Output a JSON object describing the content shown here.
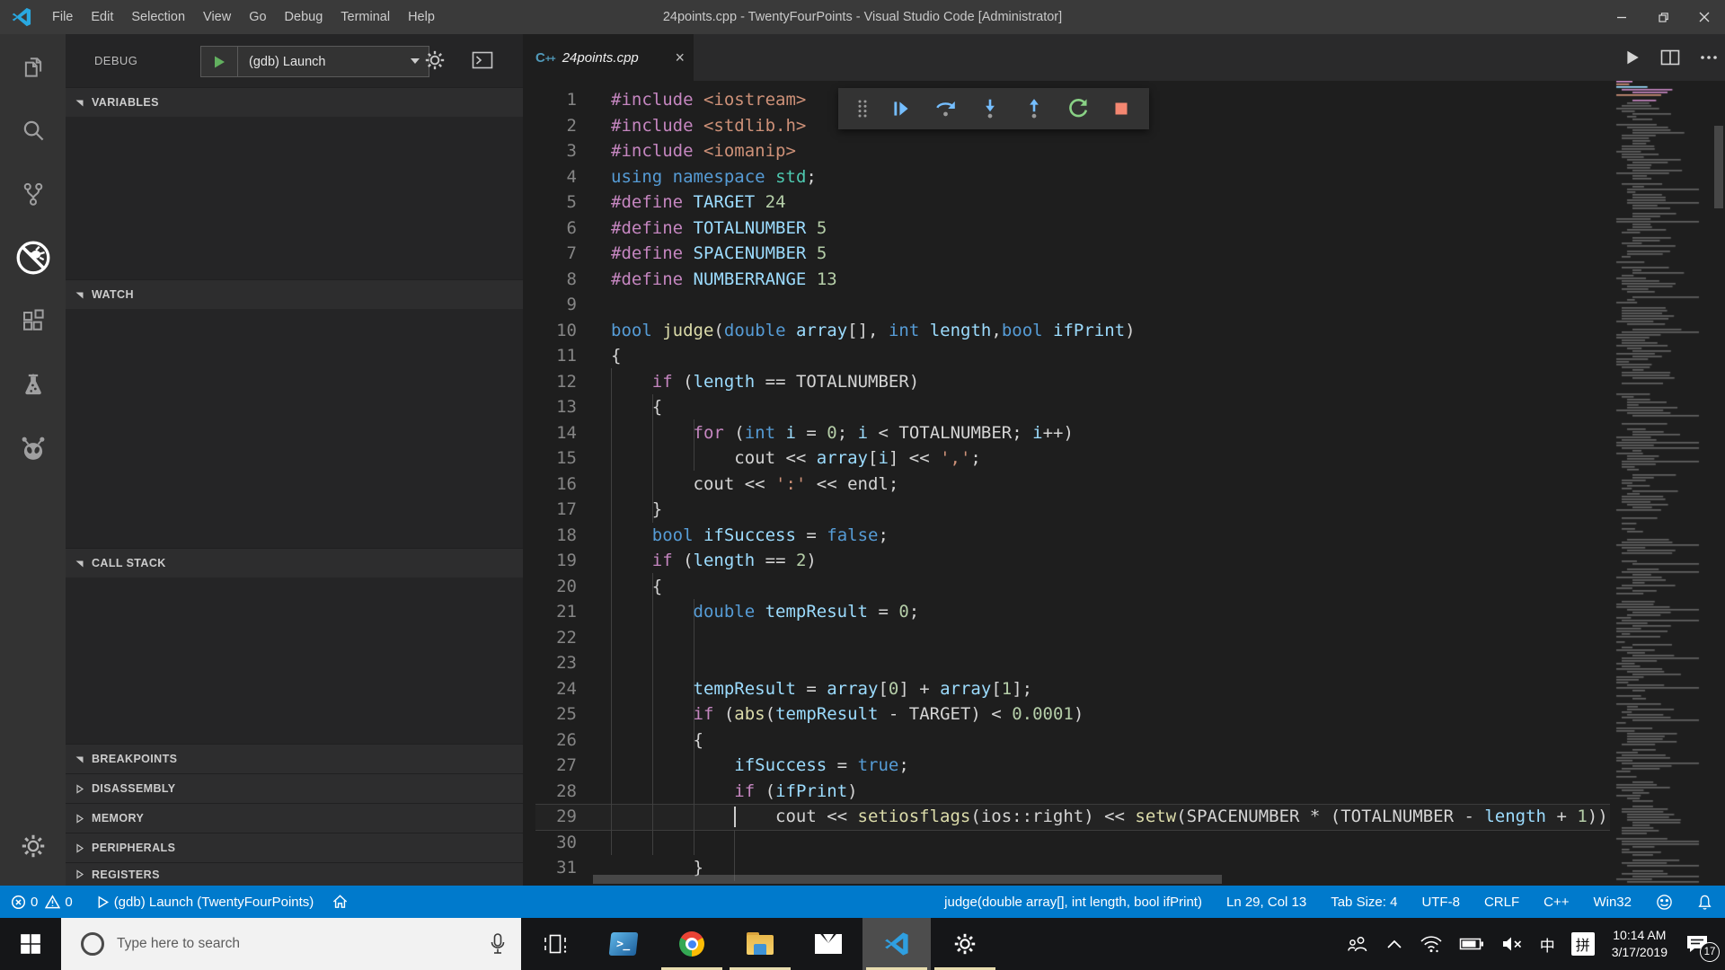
{
  "ui_colors": {
    "title_bar": "#3a3a3a",
    "activity_bar": "#333333",
    "sidebar": "#252526",
    "editor": "#1e1e1e",
    "status_bar": "#007acc",
    "taskbar": "#151618",
    "debug_continue": "#75beff",
    "debug_restart": "#89d185",
    "debug_stop": "#f48771"
  },
  "title_bar": {
    "menus": [
      "File",
      "Edit",
      "Selection",
      "View",
      "Go",
      "Debug",
      "Terminal",
      "Help"
    ],
    "title": "24points.cpp - TwentyFourPoints - Visual Studio Code [Administrator]",
    "window_buttons": [
      "minimize",
      "restore",
      "close"
    ]
  },
  "activity_bar": {
    "items": [
      "explorer",
      "search",
      "source-control",
      "debug",
      "extensions",
      "test-beaker",
      "robot"
    ],
    "active": "debug",
    "bottom": [
      "settings-gear"
    ]
  },
  "debug_panel": {
    "title": "DEBUG",
    "launch_config": "(gdb) Launch",
    "header_icons": [
      "start-debug",
      "configure-gear",
      "debug-console"
    ],
    "sections": [
      {
        "label": "VARIABLES",
        "expanded": true
      },
      {
        "label": "WATCH",
        "expanded": true
      },
      {
        "label": "CALL STACK",
        "expanded": true
      },
      {
        "label": "BREAKPOINTS",
        "expanded": true
      },
      {
        "label": "DISASSEMBLY",
        "expanded": false
      },
      {
        "label": "MEMORY",
        "expanded": false
      },
      {
        "label": "PERIPHERALS",
        "expanded": false
      },
      {
        "label": "REGISTERS",
        "expanded": false
      }
    ]
  },
  "tabs": [
    {
      "label": "24points.cpp",
      "language": "cpp",
      "active": true,
      "italic_preview": true
    }
  ],
  "tab_actions": [
    "run",
    "split-editor",
    "more-actions"
  ],
  "debug_toolbar": {
    "buttons": [
      "drag-handle",
      "continue",
      "step-over",
      "step-into",
      "step-out",
      "restart",
      "stop"
    ]
  },
  "editor": {
    "cursor": {
      "line": 29,
      "col": 13
    },
    "syntax_colors": {
      "k": "#c586c0",
      "b": "#569cd6",
      "t": "#4ec9b0",
      "f": "#dcdcaa",
      "v": "#9cdcfe",
      "n": "#b5cea8",
      "s": "#ce9178",
      "d": "#d4d4d4"
    },
    "lines": [
      {
        "num": 1,
        "tokens": [
          [
            "k",
            "#include"
          ],
          [
            "d",
            " "
          ],
          [
            "s",
            "<iostream>"
          ]
        ]
      },
      {
        "num": 2,
        "tokens": [
          [
            "k",
            "#include"
          ],
          [
            "d",
            " "
          ],
          [
            "s",
            "<stdlib.h>"
          ]
        ]
      },
      {
        "num": 3,
        "tokens": [
          [
            "k",
            "#include"
          ],
          [
            "d",
            " "
          ],
          [
            "s",
            "<iomanip>"
          ]
        ]
      },
      {
        "num": 4,
        "tokens": [
          [
            "b",
            "using"
          ],
          [
            "d",
            " "
          ],
          [
            "b",
            "namespace"
          ],
          [
            "d",
            " "
          ],
          [
            "t",
            "std"
          ],
          [
            "d",
            ";"
          ]
        ]
      },
      {
        "num": 5,
        "tokens": [
          [
            "k",
            "#define"
          ],
          [
            "d",
            " "
          ],
          [
            "v",
            "TARGET"
          ],
          [
            "d",
            " "
          ],
          [
            "n",
            "24"
          ]
        ]
      },
      {
        "num": 6,
        "tokens": [
          [
            "k",
            "#define"
          ],
          [
            "d",
            " "
          ],
          [
            "v",
            "TOTALNUMBER"
          ],
          [
            "d",
            " "
          ],
          [
            "n",
            "5"
          ]
        ]
      },
      {
        "num": 7,
        "tokens": [
          [
            "k",
            "#define"
          ],
          [
            "d",
            " "
          ],
          [
            "v",
            "SPACENUMBER"
          ],
          [
            "d",
            " "
          ],
          [
            "n",
            "5"
          ]
        ]
      },
      {
        "num": 8,
        "tokens": [
          [
            "k",
            "#define"
          ],
          [
            "d",
            " "
          ],
          [
            "v",
            "NUMBERRANGE"
          ],
          [
            "d",
            " "
          ],
          [
            "n",
            "13"
          ]
        ]
      },
      {
        "num": 9,
        "tokens": []
      },
      {
        "num": 10,
        "tokens": [
          [
            "b",
            "bool"
          ],
          [
            "d",
            " "
          ],
          [
            "f",
            "judge"
          ],
          [
            "d",
            "("
          ],
          [
            "b",
            "double"
          ],
          [
            "d",
            " "
          ],
          [
            "v",
            "array"
          ],
          [
            "d",
            "[], "
          ],
          [
            "b",
            "int"
          ],
          [
            "d",
            " "
          ],
          [
            "v",
            "length"
          ],
          [
            "d",
            ","
          ],
          [
            "b",
            "bool"
          ],
          [
            "d",
            " "
          ],
          [
            "v",
            "ifPrint"
          ],
          [
            "d",
            ")"
          ]
        ]
      },
      {
        "num": 11,
        "tokens": [
          [
            "d",
            "{"
          ]
        ]
      },
      {
        "num": 12,
        "tokens": [
          [
            "d",
            "    "
          ],
          [
            "k",
            "if"
          ],
          [
            "d",
            " ("
          ],
          [
            "v",
            "length"
          ],
          [
            "d",
            " == TOTALNUMBER)"
          ]
        ]
      },
      {
        "num": 13,
        "tokens": [
          [
            "d",
            "    {"
          ]
        ]
      },
      {
        "num": 14,
        "tokens": [
          [
            "d",
            "        "
          ],
          [
            "k",
            "for"
          ],
          [
            "d",
            " ("
          ],
          [
            "b",
            "int"
          ],
          [
            "d",
            " "
          ],
          [
            "v",
            "i"
          ],
          [
            "d",
            " = "
          ],
          [
            "n",
            "0"
          ],
          [
            "d",
            "; "
          ],
          [
            "v",
            "i"
          ],
          [
            "d",
            " < TOTALNUMBER; "
          ],
          [
            "v",
            "i"
          ],
          [
            "d",
            "++)"
          ]
        ]
      },
      {
        "num": 15,
        "tokens": [
          [
            "d",
            "            cout << "
          ],
          [
            "v",
            "array"
          ],
          [
            "d",
            "["
          ],
          [
            "v",
            "i"
          ],
          [
            "d",
            "] << "
          ],
          [
            "s",
            "','"
          ],
          [
            "d",
            ";"
          ]
        ]
      },
      {
        "num": 16,
        "tokens": [
          [
            "d",
            "        cout << "
          ],
          [
            "s",
            "':'"
          ],
          [
            "d",
            " << endl;"
          ]
        ]
      },
      {
        "num": 17,
        "tokens": [
          [
            "d",
            "    }"
          ]
        ]
      },
      {
        "num": 18,
        "tokens": [
          [
            "d",
            "    "
          ],
          [
            "b",
            "bool"
          ],
          [
            "d",
            " "
          ],
          [
            "v",
            "ifSuccess"
          ],
          [
            "d",
            " = "
          ],
          [
            "b",
            "false"
          ],
          [
            "d",
            ";"
          ]
        ]
      },
      {
        "num": 19,
        "tokens": [
          [
            "d",
            "    "
          ],
          [
            "k",
            "if"
          ],
          [
            "d",
            " ("
          ],
          [
            "v",
            "length"
          ],
          [
            "d",
            " == "
          ],
          [
            "n",
            "2"
          ],
          [
            "d",
            ")"
          ]
        ]
      },
      {
        "num": 20,
        "tokens": [
          [
            "d",
            "    {"
          ]
        ]
      },
      {
        "num": 21,
        "tokens": [
          [
            "d",
            "        "
          ],
          [
            "b",
            "double"
          ],
          [
            "d",
            " "
          ],
          [
            "v",
            "tempResult"
          ],
          [
            "d",
            " = "
          ],
          [
            "n",
            "0"
          ],
          [
            "d",
            ";"
          ]
        ]
      },
      {
        "num": 22,
        "tokens": []
      },
      {
        "num": 23,
        "tokens": []
      },
      {
        "num": 24,
        "tokens": [
          [
            "d",
            "        "
          ],
          [
            "v",
            "tempResult"
          ],
          [
            "d",
            " = "
          ],
          [
            "v",
            "array"
          ],
          [
            "d",
            "["
          ],
          [
            "n",
            "0"
          ],
          [
            "d",
            "] + "
          ],
          [
            "v",
            "array"
          ],
          [
            "d",
            "["
          ],
          [
            "n",
            "1"
          ],
          [
            "d",
            "];"
          ]
        ]
      },
      {
        "num": 25,
        "tokens": [
          [
            "d",
            "        "
          ],
          [
            "k",
            "if"
          ],
          [
            "d",
            " ("
          ],
          [
            "f",
            "abs"
          ],
          [
            "d",
            "("
          ],
          [
            "v",
            "tempResult"
          ],
          [
            "d",
            " - TARGET) < "
          ],
          [
            "n",
            "0.0001"
          ],
          [
            "d",
            ")"
          ]
        ]
      },
      {
        "num": 26,
        "tokens": [
          [
            "d",
            "        {"
          ]
        ]
      },
      {
        "num": 27,
        "tokens": [
          [
            "d",
            "            "
          ],
          [
            "v",
            "ifSuccess"
          ],
          [
            "d",
            " = "
          ],
          [
            "b",
            "true"
          ],
          [
            "d",
            ";"
          ]
        ]
      },
      {
        "num": 28,
        "tokens": [
          [
            "d",
            "            "
          ],
          [
            "k",
            "if"
          ],
          [
            "d",
            " ("
          ],
          [
            "v",
            "ifPrint"
          ],
          [
            "d",
            ")"
          ]
        ]
      },
      {
        "num": 29,
        "tokens": [
          [
            "d",
            "                cout << "
          ],
          [
            "f",
            "setiosflags"
          ],
          [
            "d",
            "(ios::right) << "
          ],
          [
            "f",
            "setw"
          ],
          [
            "d",
            "(SPACENUMBER * (TOTALNUMBER - "
          ],
          [
            "v",
            "length"
          ],
          [
            "d",
            " + "
          ],
          [
            "n",
            "1"
          ],
          [
            "d",
            "))"
          ]
        ]
      },
      {
        "num": 30,
        "tokens": []
      },
      {
        "num": 31,
        "tokens": [
          [
            "d",
            "        }"
          ]
        ]
      }
    ]
  },
  "status_bar": {
    "errors": "0",
    "warnings": "0",
    "debug_launch_label": "(gdb) Launch (TwentyFourPoints)",
    "symbol": "judge(double array[], int length, bool ifPrint)",
    "line_col": "Ln 29, Col 13",
    "tab_size": "Tab Size: 4",
    "encoding": "UTF-8",
    "eol": "CRLF",
    "language": "C++",
    "platform": "Win32",
    "icons": [
      "error-circle",
      "warning-triangle",
      "debug-play",
      "home",
      "smiley",
      "bell"
    ]
  },
  "taskbar": {
    "search_placeholder": "Type here to search",
    "apps": [
      "task-view",
      "powershell",
      "chrome",
      "file-explorer",
      "mail",
      "vscode",
      "settings"
    ],
    "active_app": "vscode",
    "running_apps": [
      "chrome",
      "file-explorer",
      "vscode",
      "settings"
    ],
    "tray_icons": [
      "people",
      "hidden-icons-chevron",
      "wifi",
      "battery",
      "volume-muted"
    ],
    "ime_primary": "中",
    "ime_pinyin": "拼",
    "clock": {
      "time": "10:14 AM",
      "date": "3/17/2019"
    },
    "notification_count": "17"
  }
}
